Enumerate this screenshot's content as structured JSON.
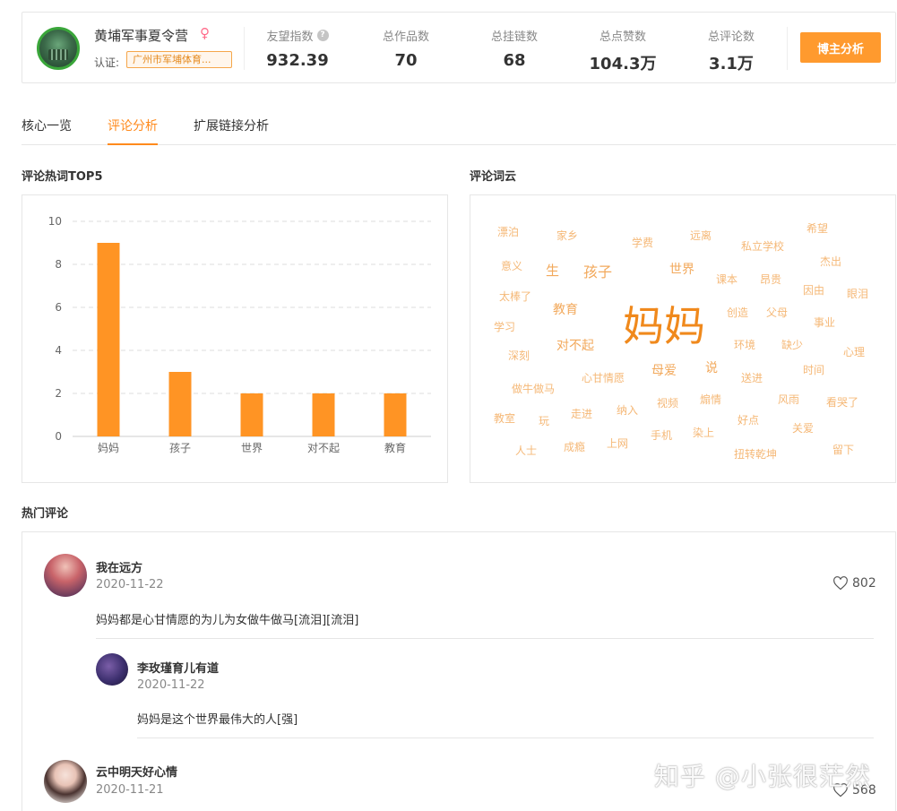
{
  "profile": {
    "name": "黄埔军事夏令营",
    "gender_symbol": "♀",
    "verify_label": "认证:",
    "verify_text": "广州市军埔体育..."
  },
  "stats": [
    {
      "label": "友望指数",
      "value": "932.39",
      "help": "?"
    },
    {
      "label": "总作品数",
      "value": "70"
    },
    {
      "label": "总挂链数",
      "value": "68"
    },
    {
      "label": "总点赞数",
      "value": "104.3万"
    },
    {
      "label": "总评论数",
      "value": "3.1万"
    }
  ],
  "blogger_button": "博主分析",
  "tabs": [
    {
      "label": "核心一览",
      "active": false
    },
    {
      "label": "评论分析",
      "active": true
    },
    {
      "label": "扩展链接分析",
      "active": false
    }
  ],
  "sections": {
    "hot_words_title": "评论热词TOP5",
    "word_cloud_title": "评论词云",
    "hot_comments_title": "热门评论"
  },
  "colors": {
    "accent": "#ff8a1c",
    "bar": "#ff9424",
    "cloud_small": "#f5b877",
    "cloud_big": "#f0891c"
  },
  "chart_data": {
    "type": "bar",
    "title": "评论热词TOP5",
    "categories": [
      "妈妈",
      "孩子",
      "世界",
      "对不起",
      "教育"
    ],
    "values": [
      9,
      3,
      2,
      2,
      2
    ],
    "ylim": [
      0,
      10
    ],
    "yticks": [
      0,
      2,
      4,
      6,
      8,
      10
    ],
    "grid": true,
    "xlabel": "",
    "ylabel": ""
  },
  "word_cloud": [
    {
      "text": "妈妈",
      "size": "big"
    },
    {
      "text": "孩子",
      "size": "medium"
    },
    {
      "text": "世界",
      "size": "medium"
    },
    {
      "text": "对不起",
      "size": "medium"
    },
    {
      "text": "教育",
      "size": "medium"
    },
    {
      "text": "生",
      "size": "medium"
    },
    {
      "text": "母爱",
      "size": "medium"
    },
    {
      "text": "说",
      "size": "medium"
    },
    {
      "text": "漂泊",
      "size": "small"
    },
    {
      "text": "家乡",
      "size": "small"
    },
    {
      "text": "学费",
      "size": "small"
    },
    {
      "text": "远离",
      "size": "small"
    },
    {
      "text": "私立学校",
      "size": "small"
    },
    {
      "text": "希望",
      "size": "small"
    },
    {
      "text": "意义",
      "size": "small"
    },
    {
      "text": "杰出",
      "size": "small"
    },
    {
      "text": "课本",
      "size": "small"
    },
    {
      "text": "昂贵",
      "size": "small"
    },
    {
      "text": "太棒了",
      "size": "small"
    },
    {
      "text": "因由",
      "size": "small"
    },
    {
      "text": "眼泪",
      "size": "small"
    },
    {
      "text": "创造",
      "size": "small"
    },
    {
      "text": "父母",
      "size": "small"
    },
    {
      "text": "学习",
      "size": "small"
    },
    {
      "text": "事业",
      "size": "small"
    },
    {
      "text": "环境",
      "size": "small"
    },
    {
      "text": "缺少",
      "size": "small"
    },
    {
      "text": "深刻",
      "size": "small"
    },
    {
      "text": "心理",
      "size": "small"
    },
    {
      "text": "时间",
      "size": "small"
    },
    {
      "text": "心甘情愿",
      "size": "small"
    },
    {
      "text": "送进",
      "size": "small"
    },
    {
      "text": "做牛做马",
      "size": "small"
    },
    {
      "text": "视频",
      "size": "small"
    },
    {
      "text": "煽情",
      "size": "small"
    },
    {
      "text": "风雨",
      "size": "small"
    },
    {
      "text": "看哭了",
      "size": "small"
    },
    {
      "text": "教室",
      "size": "small"
    },
    {
      "text": "玩",
      "size": "small"
    },
    {
      "text": "走进",
      "size": "small"
    },
    {
      "text": "纳入",
      "size": "small"
    },
    {
      "text": "好点",
      "size": "small"
    },
    {
      "text": "关爱",
      "size": "small"
    },
    {
      "text": "染上",
      "size": "small"
    },
    {
      "text": "手机",
      "size": "small"
    },
    {
      "text": "人士",
      "size": "small"
    },
    {
      "text": "成瘾",
      "size": "small"
    },
    {
      "text": "上网",
      "size": "small"
    },
    {
      "text": "扭转乾坤",
      "size": "small"
    },
    {
      "text": "留下",
      "size": "small"
    }
  ],
  "comments": [
    {
      "user": "我在远方",
      "date": "2020-11-22",
      "text": "妈妈都是心甘情愿的为儿为女做牛做马[流泪][流泪]",
      "likes": "802"
    },
    {
      "user": "李玫瑾育儿有道",
      "date": "2020-11-22",
      "text": "妈妈是这个世界最伟大的人[强]",
      "reply": true
    },
    {
      "user": "云中明天好心情",
      "date": "2020-11-21",
      "likes": "568"
    }
  ],
  "watermark": "知乎 @小张很茫然"
}
